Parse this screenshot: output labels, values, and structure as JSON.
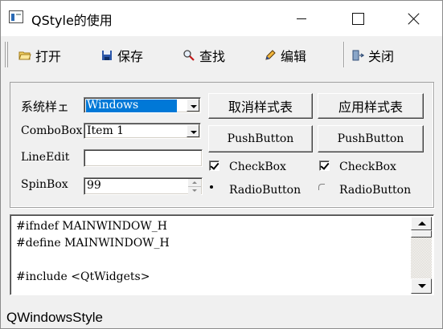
{
  "window": {
    "title": "QStyle的使用",
    "icon": "app-window-icon"
  },
  "toolbar": {
    "items": [
      {
        "label": "打开",
        "icon": "open-folder-icon"
      },
      {
        "label": "保存",
        "icon": "save-disk-icon"
      },
      {
        "label": "查找",
        "icon": "find-icon"
      },
      {
        "label": "编辑",
        "icon": "edit-pencil-icon"
      },
      {
        "label": "关闭",
        "icon": "close-door-icon"
      }
    ]
  },
  "form": {
    "style_label": "系统样ェ",
    "style_value": "Windows",
    "combobox_label": "ComboBox",
    "combobox_value": "Item 1",
    "lineedit_label": "LineEdit",
    "lineedit_value": "",
    "spinbox_label": "SpinBox",
    "spinbox_value": "99"
  },
  "buttons": {
    "cancel_stylesheet": "取消样式表",
    "apply_stylesheet": "应用样式表",
    "push_button_1": "PushButton",
    "push_button_2": "PushButton"
  },
  "checks": {
    "checkbox_1": {
      "label": "CheckBox",
      "checked": true
    },
    "checkbox_2": {
      "label": "CheckBox",
      "checked": true
    },
    "radio_1": {
      "label": "RadioButton",
      "selected": true
    },
    "radio_2": {
      "label": "RadioButton",
      "selected": false
    }
  },
  "editor": {
    "lines": [
      "#ifndef MAINWINDOW_H",
      "#define MAINWINDOW_H",
      "",
      "#include <QtWidgets>"
    ]
  },
  "status": {
    "text": "QWindowsStyle"
  },
  "colors": {
    "selection": "#0078d7",
    "background": "#f0f0f0"
  }
}
